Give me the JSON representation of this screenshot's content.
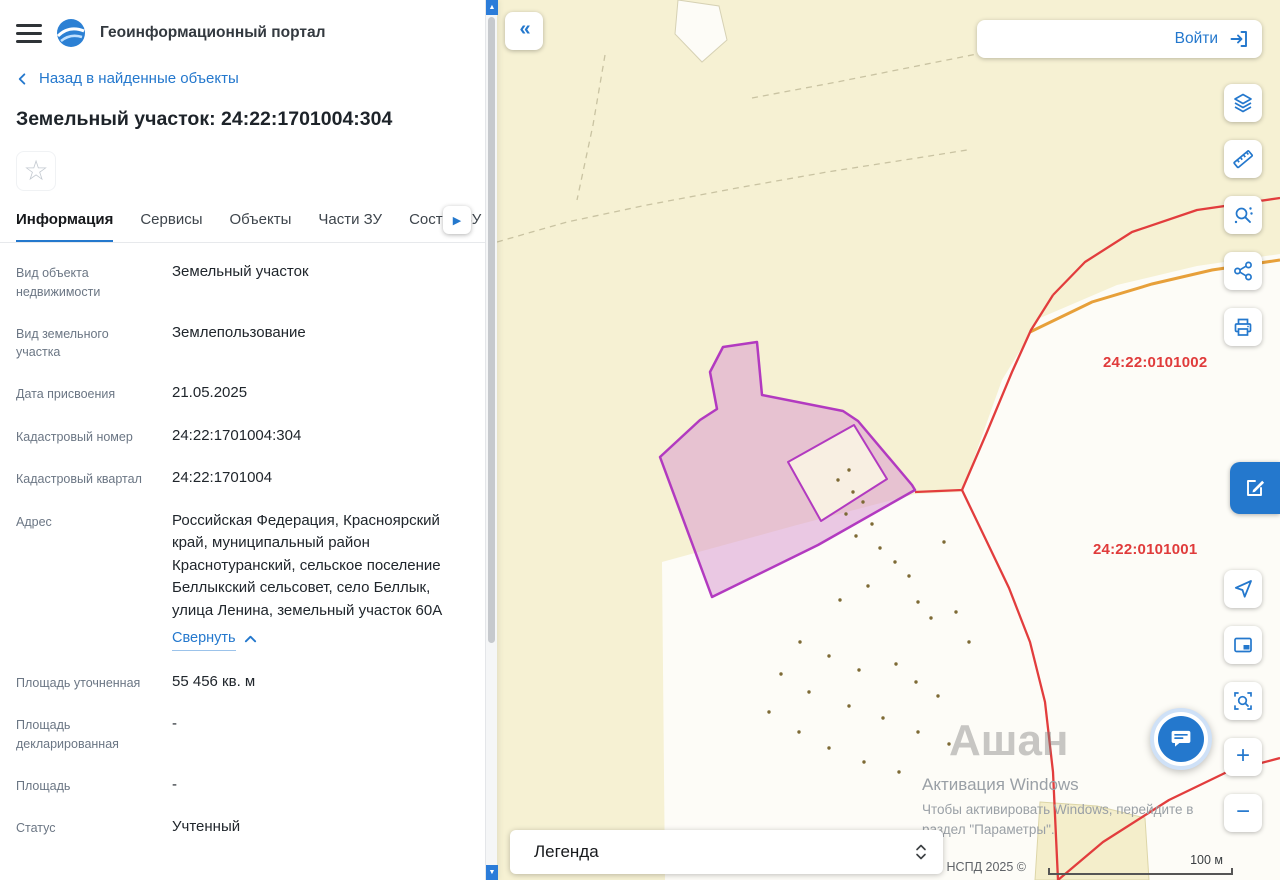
{
  "app": {
    "title": "Геоинформационный портал"
  },
  "nav": {
    "back": "Назад в найденные объекты"
  },
  "page": {
    "title": "Земельный участок: 24:22:1701004:304"
  },
  "tabs": {
    "items": [
      {
        "label": "Информация"
      },
      {
        "label": "Сервисы"
      },
      {
        "label": "Объекты"
      },
      {
        "label": "Части ЗУ"
      },
      {
        "label": "Состав ЗУ"
      }
    ]
  },
  "info": {
    "fields": [
      {
        "label": "Вид объекта недвижимости",
        "value": "Земельный участок"
      },
      {
        "label": "Вид земельного участка",
        "value": "Землепользование"
      },
      {
        "label": "Дата присвоения",
        "value": "21.05.2025"
      },
      {
        "label": "Кадастровый номер",
        "value": "24:22:1701004:304"
      },
      {
        "label": "Кадастровый квартал",
        "value": "24:22:1701004"
      },
      {
        "label": "Адрес",
        "value": "Российская Федерация, Красноярский край, муниципальный район Краснотуранский, сельское поселение Беллыкский сельсовет, село Беллык, улица Ленина, земельный участок 60А"
      },
      {
        "label": "Площадь уточненная",
        "value": "55 456 кв. м"
      },
      {
        "label": "Площадь декларированная",
        "value": "-"
      },
      {
        "label": "Площадь",
        "value": "-"
      },
      {
        "label": "Статус",
        "value": "Учтенный"
      }
    ],
    "collapse_label": "Свернуть"
  },
  "map": {
    "login_label": "Войти",
    "legend_label": "Легенда",
    "labels": {
      "quarter_top": "24:22:0101002",
      "quarter_bottom": "24:22:0101001",
      "place": "Ашан"
    },
    "watermark": {
      "line1": "Активация Windows",
      "line2": "Чтобы активировать Windows, перейдите в",
      "line3": "раздел \"Параметры\"."
    },
    "attribution": "НСПД 2025 ©",
    "scale_label": "100 м"
  },
  "icons": {
    "star": "☆",
    "collapse_panel": "«",
    "tab_scroll": "▶",
    "zoom_in": "+",
    "zoom_out": "−"
  },
  "colors": {
    "accent_blue": "#2478cd",
    "boundary_red": "#e23d3d",
    "parcel_purple": "#b23ac0"
  }
}
